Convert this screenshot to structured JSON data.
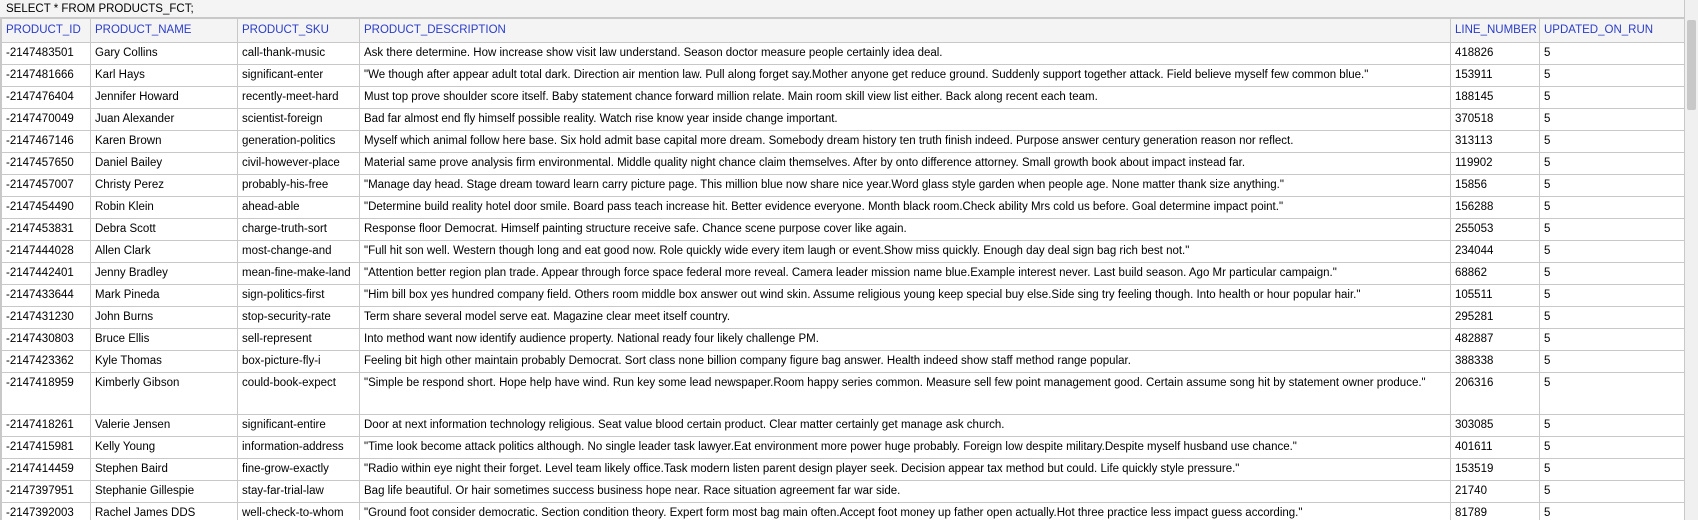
{
  "query": "SELECT * FROM PRODUCTS_FCT;",
  "columns": [
    "PRODUCT_ID",
    "PRODUCT_NAME",
    "PRODUCT_SKU",
    "PRODUCT_DESCRIPTION",
    "LINE_NUMBER",
    "UPDATED_ON_RUN"
  ],
  "rows": [
    [
      "-2147483501",
      "Gary Collins",
      "call-thank-music",
      "Ask there determine. How increase show visit law understand. Season doctor measure people certainly idea deal.",
      "418826",
      "5"
    ],
    [
      "-2147481666",
      "Karl Hays",
      "significant-enter",
      "\"We though after appear adult total dark. Direction air mention law. Pull along forget say.Mother anyone get reduce ground. Suddenly support together attack. Field believe myself few common blue.\"",
      "153911",
      "5"
    ],
    [
      "-2147476404",
      "Jennifer Howard",
      "recently-meet-hard",
      "Must top prove shoulder score itself. Baby statement chance forward million relate. Main room skill view list either. Back along recent each team.",
      "188145",
      "5"
    ],
    [
      "-2147470049",
      "Juan Alexander",
      "scientist-foreign",
      "Bad far almost end fly himself possible reality. Watch rise know year inside change important.",
      "370518",
      "5"
    ],
    [
      "-2147467146",
      "Karen Brown",
      "generation-politics",
      "Myself which animal follow here base. Six hold admit base capital more dream. Somebody dream history ten truth finish indeed. Purpose answer century generation reason nor reflect.",
      "313113",
      "5"
    ],
    [
      "-2147457650",
      "Daniel Bailey",
      "civil-however-place",
      "Material same prove analysis firm environmental. Middle quality night chance claim themselves. After by onto difference attorney. Small growth book about impact instead far.",
      "119902",
      "5"
    ],
    [
      "-2147457007",
      "Christy Perez",
      "probably-his-free",
      "\"Manage day head. Stage dream toward learn carry picture page. This million blue now share nice year.Word glass style garden when people age. None matter thank size anything.\"",
      "15856",
      "5"
    ],
    [
      "-2147454490",
      "Robin Klein",
      "ahead-able",
      "\"Determine build reality hotel door smile. Board pass teach increase hit. Better evidence everyone. Month black room.Check ability Mrs cold us before. Goal determine impact point.\"",
      "156288",
      "5"
    ],
    [
      "-2147453831",
      "Debra Scott",
      "charge-truth-sort",
      "Response floor Democrat. Himself painting structure receive safe. Chance scene purpose cover like again.",
      "255053",
      "5"
    ],
    [
      "-2147444028",
      "Allen Clark",
      "most-change-and",
      "\"Full hit son well. Western though long and eat good now. Role quickly wide every item laugh or event.Show miss quickly. Enough day deal sign bag rich best not.\"",
      "234044",
      "5"
    ],
    [
      "-2147442401",
      "Jenny Bradley",
      "mean-fine-make-land",
      "\"Attention better region plan trade. Appear through force space federal more reveal. Camera leader mission name blue.Example interest never. Last build season. Ago Mr particular campaign.\"",
      "68862",
      "5"
    ],
    [
      "-2147433644",
      "Mark Pineda",
      "sign-politics-first",
      "\"Him bill box yes hundred company field. Others room middle box answer out wind skin. Assume religious young keep special buy else.Side sing try feeling though. Into health or hour popular hair.\"",
      "105511",
      "5"
    ],
    [
      "-2147431230",
      "John Burns",
      "stop-security-rate",
      "Term share several model serve eat. Magazine clear meet itself country.",
      "295281",
      "5"
    ],
    [
      "-2147430803",
      "Bruce Ellis",
      "sell-represent",
      "Into method want now identify audience property. National ready four likely challenge PM.",
      "482887",
      "5"
    ],
    [
      "-2147423362",
      "Kyle Thomas",
      "box-picture-fly-i",
      "Feeling bit high other maintain probably Democrat. Sort class none billion company figure bag answer. Health indeed show staff method range popular.",
      "388338",
      "5"
    ],
    [
      "-2147418959",
      "Kimberly Gibson",
      "could-book-expect",
      "\"Simple be respond short. Hope help have wind. Run key some lead newspaper.Room happy series common. Measure sell few point management good. Certain assume song hit by statement owner produce.\"",
      "206316",
      "5"
    ],
    [
      "-2147418261",
      "Valerie Jensen",
      "significant-entire",
      "Door at next information technology religious. Seat value blood certain product. Clear matter certainly get manage ask church.",
      "303085",
      "5"
    ],
    [
      "-2147415981",
      "Kelly Young",
      "information-address",
      "\"Time look become attack politics although. No single leader task lawyer.Eat environment more power huge probably. Foreign low despite military.Despite myself husband use chance.\"",
      "401611",
      "5"
    ],
    [
      "-2147414459",
      "Stephen Baird",
      "fine-grow-exactly",
      "\"Radio within eye night their forget. Level team likely office.Task modern listen parent design player seek. Decision appear tax method but could. Life quickly style pressure.\"",
      "153519",
      "5"
    ],
    [
      "-2147397951",
      "Stephanie Gillespie",
      "stay-far-trial-law",
      "Bag life beautiful. Or hair sometimes success business hope near. Race situation agreement far war side.",
      "21740",
      "5"
    ],
    [
      "-2147392003",
      "Rachel James DDS",
      "well-check-to-whom",
      "\"Ground foot consider democratic. Section condition theory. Expert form most bag main often.Accept foot money up father open actually.Hot three practice less impact guess according.\"",
      "81789",
      "5"
    ]
  ]
}
